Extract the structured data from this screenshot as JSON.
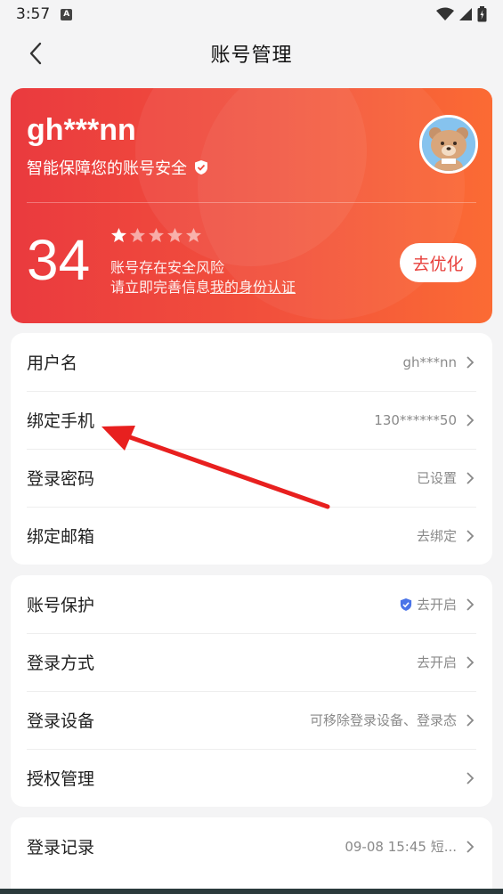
{
  "status_bar": {
    "time": "3:57",
    "notif_icon_letter": "A"
  },
  "header": {
    "title": "账号管理"
  },
  "security_card": {
    "username": "gh***nn",
    "subtitle": "智能保障您的账号安全",
    "score": "34",
    "stars_filled": 1,
    "stars_total": 5,
    "risk_line1": "账号存在安全风险",
    "risk_line2_prefix": "请立即完善信息",
    "risk_link": "我的身份认证",
    "optimize_label": "去优化",
    "gradient_start": "#ea3a3e",
    "gradient_end": "#fb6b34"
  },
  "section1": [
    {
      "label": "用户名",
      "value": "gh***nn"
    },
    {
      "label": "绑定手机",
      "value": "130******50"
    },
    {
      "label": "登录密码",
      "value": "已设置"
    },
    {
      "label": "绑定邮箱",
      "value": "去绑定"
    }
  ],
  "section2": [
    {
      "label": "账号保护",
      "value": "去开启",
      "icon": "shield-check-icon"
    },
    {
      "label": "登录方式",
      "value": "去开启"
    },
    {
      "label": "登录设备",
      "value": "可移除登录设备、登录态"
    },
    {
      "label": "授权管理",
      "value": ""
    }
  ],
  "section3": [
    {
      "label": "登录记录",
      "value": "09-08 15:45 短..."
    }
  ],
  "annotation": {
    "arrow_color": "#e8201f"
  }
}
